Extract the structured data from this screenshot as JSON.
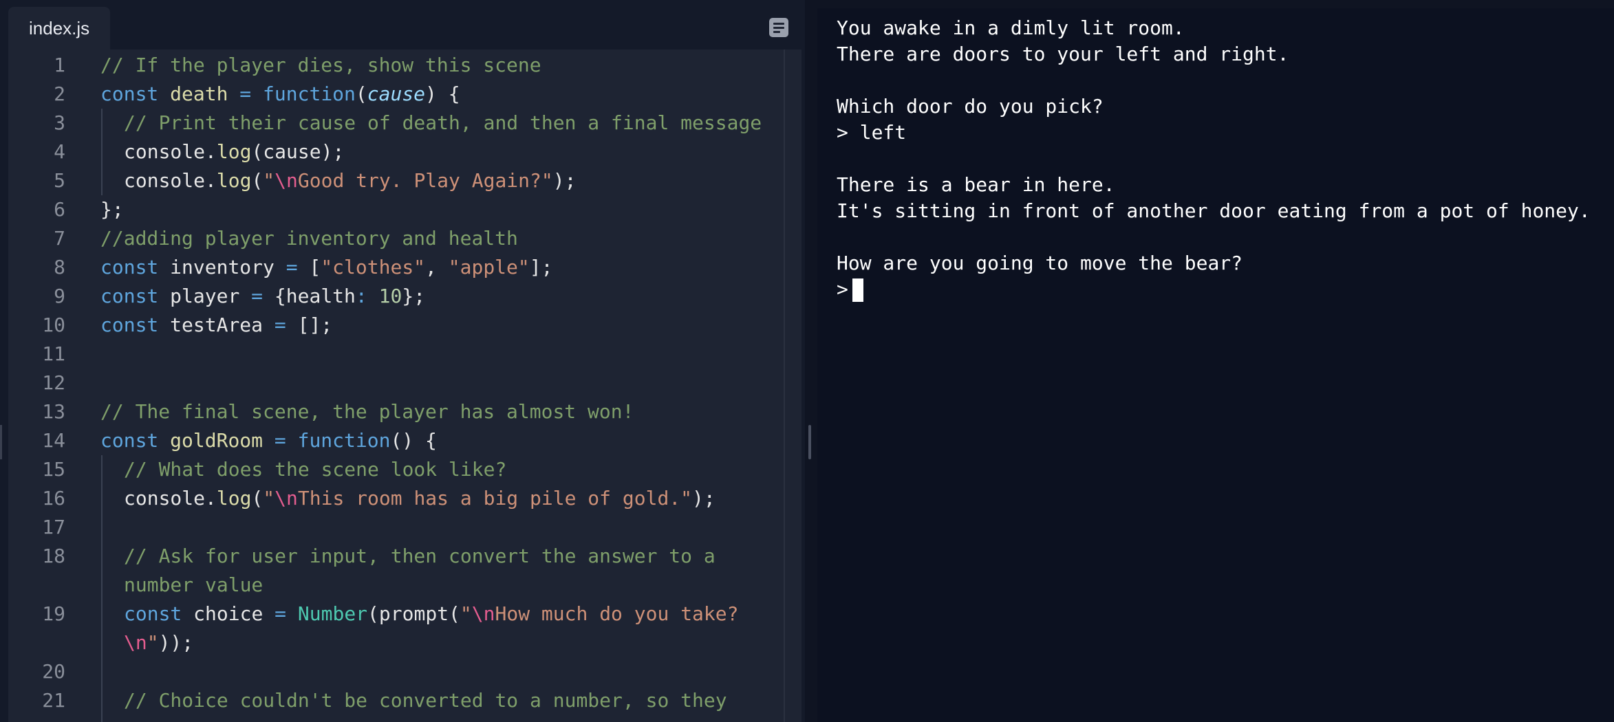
{
  "editor": {
    "tab_label": "index.js",
    "menu_icon": "list-icon",
    "lines": [
      {
        "num": "1",
        "tokens": [
          {
            "t": "// If the player dies, show this scene",
            "c": "com"
          }
        ]
      },
      {
        "num": "2",
        "tokens": [
          {
            "t": "const ",
            "c": "kw"
          },
          {
            "t": "death",
            "c": "fn"
          },
          {
            "t": " = ",
            "c": "kw"
          },
          {
            "t": "function",
            "c": "kw"
          },
          {
            "t": "(",
            "c": "var"
          },
          {
            "t": "cause",
            "c": "it"
          },
          {
            "t": ") {",
            "c": "var"
          }
        ]
      },
      {
        "num": "3",
        "indent": true,
        "tokens": [
          {
            "t": "// Print their cause of death, and then a final message",
            "c": "com"
          }
        ]
      },
      {
        "num": "4",
        "indent": true,
        "tokens": [
          {
            "t": "console.",
            "c": "var"
          },
          {
            "t": "log",
            "c": "fn"
          },
          {
            "t": "(cause);",
            "c": "var"
          }
        ]
      },
      {
        "num": "5",
        "indent": true,
        "tokens": [
          {
            "t": "console.",
            "c": "var"
          },
          {
            "t": "log",
            "c": "fn"
          },
          {
            "t": "(",
            "c": "var"
          },
          {
            "t": "\"",
            "c": "str"
          },
          {
            "t": "\\n",
            "c": "esc"
          },
          {
            "t": "Good try. Play Again?\"",
            "c": "str"
          },
          {
            "t": ");",
            "c": "var"
          }
        ]
      },
      {
        "num": "6",
        "tokens": [
          {
            "t": "};",
            "c": "var"
          }
        ]
      },
      {
        "num": "7",
        "tokens": [
          {
            "t": "//adding player inventory and health",
            "c": "com"
          }
        ]
      },
      {
        "num": "8",
        "tokens": [
          {
            "t": "const ",
            "c": "kw"
          },
          {
            "t": "inventory ",
            "c": "var"
          },
          {
            "t": "= ",
            "c": "kw"
          },
          {
            "t": "[",
            "c": "var"
          },
          {
            "t": "\"clothes\"",
            "c": "str"
          },
          {
            "t": ", ",
            "c": "var"
          },
          {
            "t": "\"apple\"",
            "c": "str"
          },
          {
            "t": "];",
            "c": "var"
          }
        ]
      },
      {
        "num": "9",
        "tokens": [
          {
            "t": "const ",
            "c": "kw"
          },
          {
            "t": "player ",
            "c": "var"
          },
          {
            "t": "= ",
            "c": "kw"
          },
          {
            "t": "{health",
            "c": "var"
          },
          {
            "t": ": ",
            "c": "kw"
          },
          {
            "t": "10",
            "c": "num"
          },
          {
            "t": "};",
            "c": "var"
          }
        ]
      },
      {
        "num": "10",
        "tokens": [
          {
            "t": "const ",
            "c": "kw"
          },
          {
            "t": "testArea ",
            "c": "var"
          },
          {
            "t": "= ",
            "c": "kw"
          },
          {
            "t": "[];",
            "c": "var"
          }
        ]
      },
      {
        "num": "11",
        "tokens": []
      },
      {
        "num": "12",
        "tokens": []
      },
      {
        "num": "13",
        "tokens": [
          {
            "t": "// The final scene, the player has almost won!",
            "c": "com"
          }
        ]
      },
      {
        "num": "14",
        "tokens": [
          {
            "t": "const ",
            "c": "kw"
          },
          {
            "t": "goldRoom",
            "c": "fn"
          },
          {
            "t": " = ",
            "c": "kw"
          },
          {
            "t": "function",
            "c": "kw"
          },
          {
            "t": "() {",
            "c": "var"
          }
        ]
      },
      {
        "num": "15",
        "indent": true,
        "tokens": [
          {
            "t": "// What does the scene look like?",
            "c": "com"
          }
        ]
      },
      {
        "num": "16",
        "indent": true,
        "tokens": [
          {
            "t": "console.",
            "c": "var"
          },
          {
            "t": "log",
            "c": "fn"
          },
          {
            "t": "(",
            "c": "var"
          },
          {
            "t": "\"",
            "c": "str"
          },
          {
            "t": "\\n",
            "c": "esc"
          },
          {
            "t": "This room has a big pile of gold.\"",
            "c": "str"
          },
          {
            "t": ");",
            "c": "var"
          }
        ]
      },
      {
        "num": "17",
        "indent": true,
        "tokens": []
      },
      {
        "num": "18",
        "indent": true,
        "tokens": [
          {
            "t": "// Ask for user input, then convert the answer to a",
            "c": "com"
          }
        ]
      },
      {
        "num": "",
        "indent": true,
        "tokens": [
          {
            "t": "number value",
            "c": "com"
          }
        ]
      },
      {
        "num": "19",
        "indent": true,
        "tokens": [
          {
            "t": "const ",
            "c": "kw"
          },
          {
            "t": "choice ",
            "c": "var"
          },
          {
            "t": "= ",
            "c": "kw"
          },
          {
            "t": "Number",
            "c": "cls"
          },
          {
            "t": "(prompt(",
            "c": "var"
          },
          {
            "t": "\"",
            "c": "str"
          },
          {
            "t": "\\n",
            "c": "esc"
          },
          {
            "t": "How much do you take?",
            "c": "str"
          }
        ]
      },
      {
        "num": "",
        "indent": true,
        "tokens": [
          {
            "t": "\\n",
            "c": "esc"
          },
          {
            "t": "\"",
            "c": "str"
          },
          {
            "t": "));",
            "c": "var"
          }
        ]
      },
      {
        "num": "20",
        "indent": true,
        "tokens": []
      },
      {
        "num": "21",
        "indent": true,
        "tokens": [
          {
            "t": "// Choice couldn't be converted to a number, so they",
            "c": "com"
          }
        ]
      }
    ]
  },
  "console": {
    "lines": [
      "You awake in a dimly lit room.",
      "There are doors to your left and right.",
      "",
      "Which door do you pick?",
      "> left",
      "",
      "There is a bear in here.",
      "It's sitting in front of another door eating from a pot of honey.",
      "",
      "How are you going to move the bear?"
    ],
    "prompt": ">",
    "input_value": ""
  }
}
